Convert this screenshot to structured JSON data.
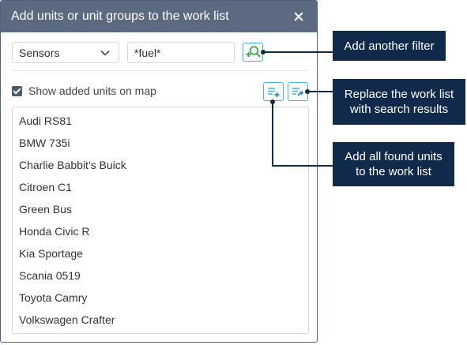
{
  "dialog": {
    "title": "Add units or unit groups to the work list",
    "close_icon": "close-icon"
  },
  "filter": {
    "type_select_value": "Sensors",
    "search_value": "*fuel*",
    "add_filter_icon": "add-filter-icon"
  },
  "options": {
    "show_on_map_label": "Show added units on map",
    "show_on_map_checked": true
  },
  "actions": {
    "add_all_icon": "add-all-to-list-icon",
    "replace_icon": "replace-list-icon"
  },
  "units": [
    {
      "name": "Audi RS81"
    },
    {
      "name": "BMW 735i"
    },
    {
      "name": "Charlie Babbit's Buick"
    },
    {
      "name": "Citroen C1"
    },
    {
      "name": "Green Bus"
    },
    {
      "name": "Honda Civic R"
    },
    {
      "name": "Kia Sportage"
    },
    {
      "name": "Scania 0519"
    },
    {
      "name": "Toyota Camry"
    },
    {
      "name": "Volkswagen Crafter"
    }
  ],
  "callouts": {
    "add_filter": "Add another filter",
    "replace_line1": "Replace the work list",
    "replace_line2": "with search results",
    "add_all_line1": "Add all found units",
    "add_all_line2": "to the work list"
  },
  "colors": {
    "titlebar": "#5b6981",
    "accent": "#3fb6e8",
    "add_icon": "#3ea84a",
    "callout_bg": "#102a4c"
  }
}
